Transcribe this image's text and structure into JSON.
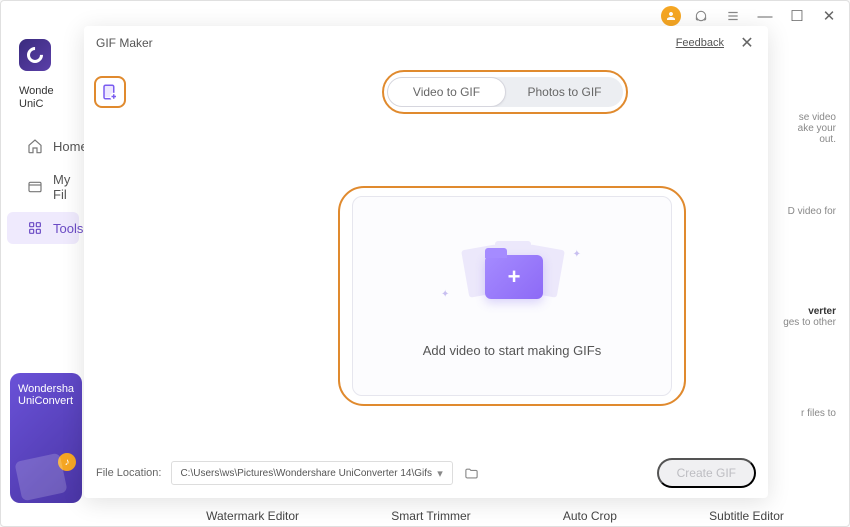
{
  "titlebar": {
    "min": "—",
    "max": "☐",
    "close": "✕"
  },
  "brand_line1": "Wonde",
  "brand_line2": "UniC",
  "nav": {
    "home": "Home",
    "files": "My Fil",
    "tools": "Tools"
  },
  "promo": {
    "line1": "Wondersha",
    "line2": "UniConvert"
  },
  "background_cards": {
    "c1a": "se video",
    "c1b": "ake your",
    "c1c": "out.",
    "c2": "D video for",
    "c3a": "verter",
    "c3b": "ges to other",
    "c4": "r files to"
  },
  "bottom_tools": {
    "watermark": "Watermark Editor",
    "trimmer": "Smart Trimmer",
    "crop": "Auto Crop",
    "subtitle": "Subtitle Editor"
  },
  "modal": {
    "title": "GIF Maker",
    "feedback": "Feedback",
    "tab_video": "Video to GIF",
    "tab_photos": "Photos to GIF",
    "drop_text": "Add video to start making GIFs",
    "footer_label": "File Location:",
    "path": "C:\\Users\\ws\\Pictures\\Wondershare UniConverter 14\\Gifs",
    "create": "Create GIF"
  }
}
